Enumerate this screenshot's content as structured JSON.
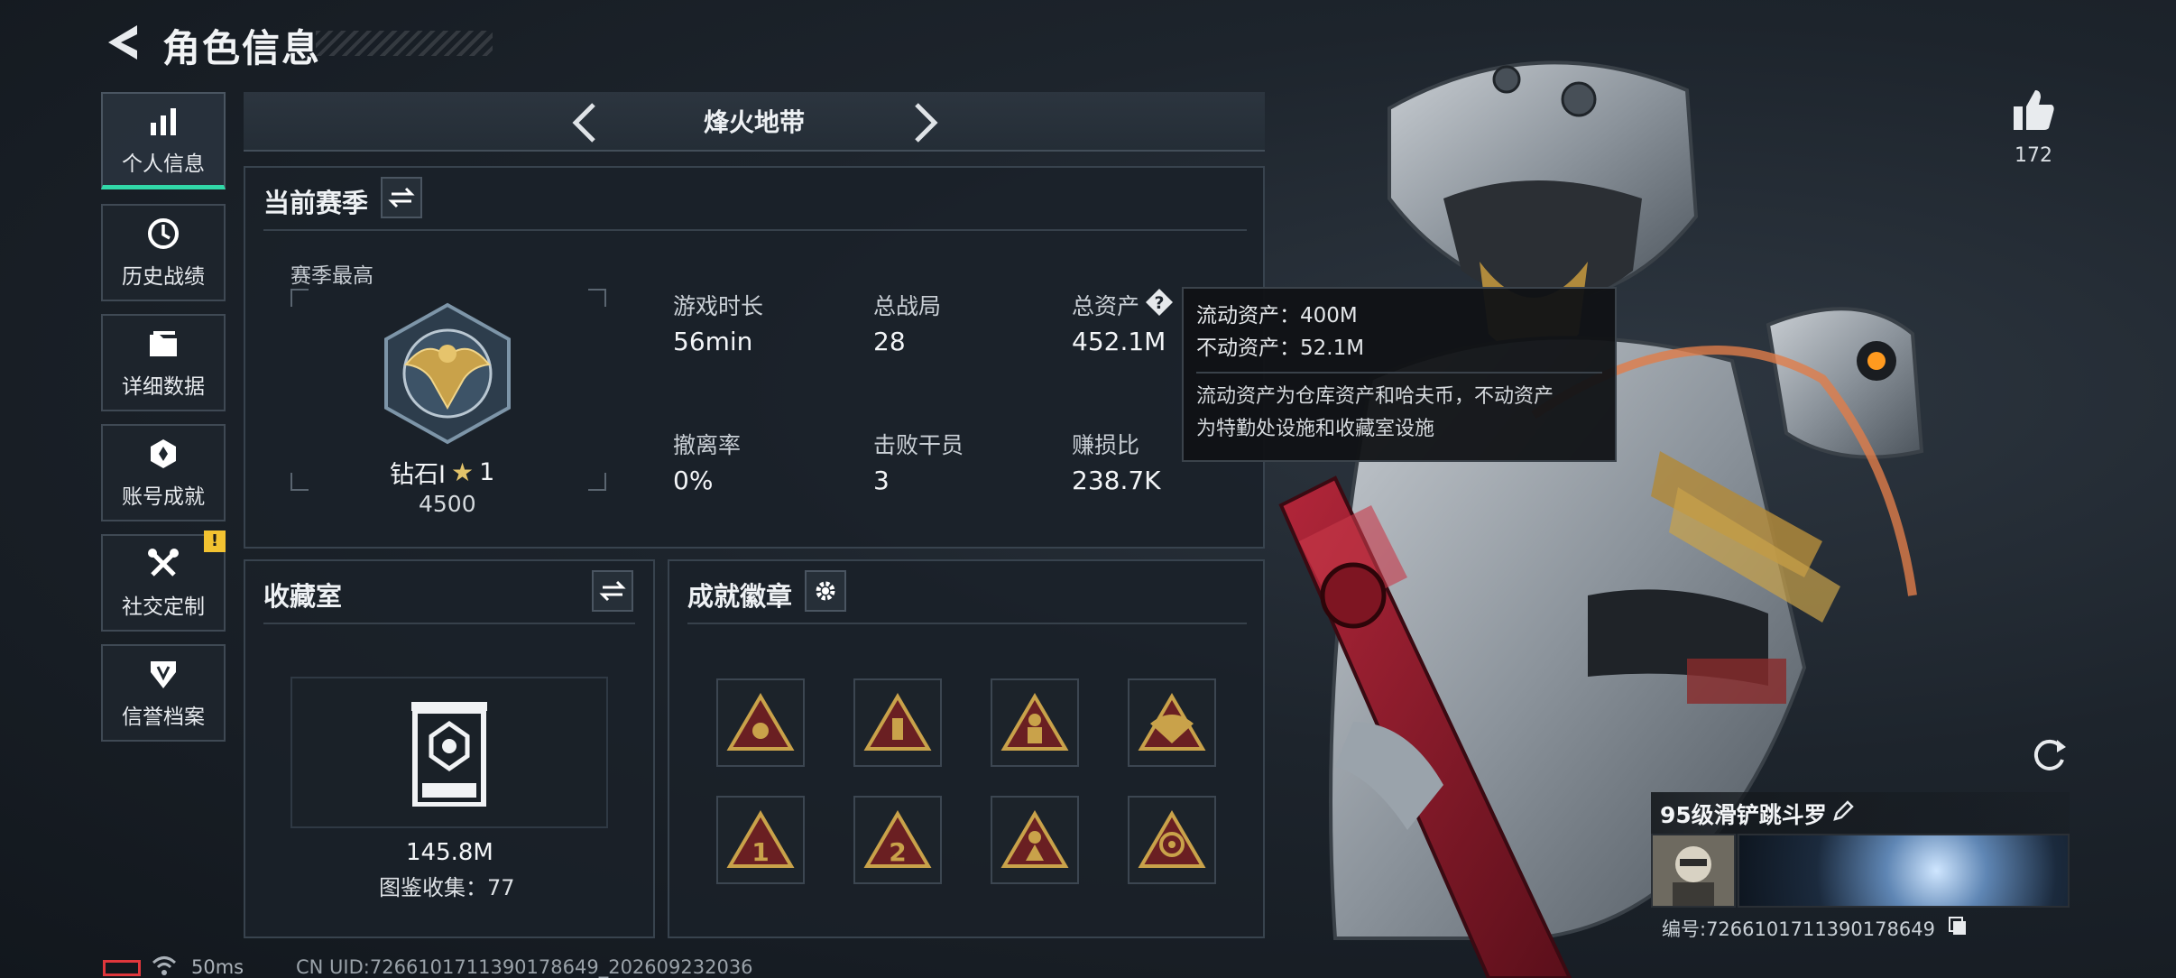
{
  "header": {
    "title": "角色信息"
  },
  "sidebar": {
    "items": [
      {
        "label": "个人信息",
        "icon": "bar-chart-icon",
        "active": true
      },
      {
        "label": "历史战绩",
        "icon": "clock-icon"
      },
      {
        "label": "详细数据",
        "icon": "folder-icon"
      },
      {
        "label": "账号成就",
        "icon": "achievement-icon"
      },
      {
        "label": "社交定制",
        "icon": "tools-icon",
        "alert": "!"
      },
      {
        "label": "信誉档案",
        "icon": "shield-icon"
      }
    ]
  },
  "mode": {
    "title": "烽火地带"
  },
  "season": {
    "title": "当前赛季",
    "best_label": "赛季最高",
    "rank_name": "钻石Ⅰ",
    "rank_stars": "1",
    "rank_score": "4500",
    "stats": [
      {
        "label": "游戏时长",
        "value": "56min"
      },
      {
        "label": "总战局",
        "value": "28"
      },
      {
        "label": "总资产",
        "value": "452.1M"
      },
      {
        "label": "撤离率",
        "value": "0%"
      },
      {
        "label": "击败干员",
        "value": "3"
      },
      {
        "label": "赚损比",
        "value": "238.7K"
      }
    ]
  },
  "tooltip": {
    "line1": "流动资产：400M",
    "line2": "不动资产：52.1M",
    "desc1": "流动资产为仓库资产和哈夫币，不动资产",
    "desc2": "为特勤处设施和收藏室设施"
  },
  "collection": {
    "title": "收藏室",
    "value": "145.8M",
    "count_label": "图鉴收集：77"
  },
  "achievements": {
    "title": "成就徽章"
  },
  "profile": {
    "likes": "172",
    "player_name": "95级滑铲跳斗罗",
    "player_id": "编号:7266101711390178649"
  },
  "status": {
    "ping": "50ms",
    "uid": "CN UID:7266101711390178649_202609232036"
  },
  "colors": {
    "accent": "#31d8a8",
    "gold": "#c9a24a",
    "badge_red": "#6a1f22",
    "alert": "#f2c231"
  }
}
